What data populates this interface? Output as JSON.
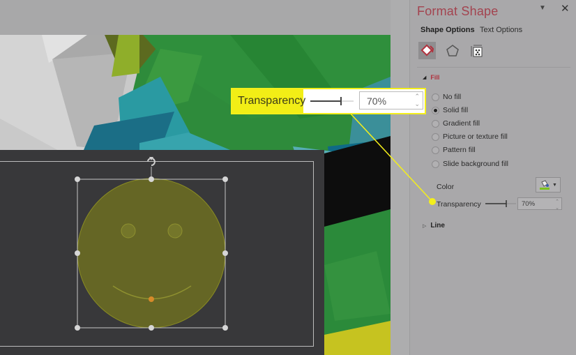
{
  "panel": {
    "title": "Format Shape",
    "tabs": [
      {
        "label": "Shape Options",
        "active": true
      },
      {
        "label": "Text Options",
        "active": false
      }
    ],
    "icon_tabs": [
      {
        "name": "fill-line-icon",
        "active": true
      },
      {
        "name": "effects-pentagon-icon",
        "active": false
      },
      {
        "name": "size-properties-icon",
        "active": false
      }
    ],
    "fill_section": {
      "label": "Fill",
      "expanded": true,
      "options": [
        {
          "label": "No fill",
          "checked": false
        },
        {
          "label": "Solid fill",
          "checked": true
        },
        {
          "label": "Gradient fill",
          "checked": false
        },
        {
          "label": "Picture or texture fill",
          "checked": false
        },
        {
          "label": "Pattern fill",
          "checked": false
        },
        {
          "label": "Slide background fill",
          "checked": false
        }
      ],
      "color_label": "Color",
      "transparency_label": "Transparency",
      "transparency_value": "70%",
      "transparency_fraction": 0.7
    },
    "line_section": {
      "label": "Line",
      "expanded": false
    }
  },
  "callout": {
    "label": "Transparency",
    "value": "70%",
    "highlight_color": "#f2ee16"
  },
  "colors": {
    "panel_title": "#a3434f",
    "shape_fill": "#7b7d1e",
    "accent_yellow": "#f4ef1b"
  }
}
